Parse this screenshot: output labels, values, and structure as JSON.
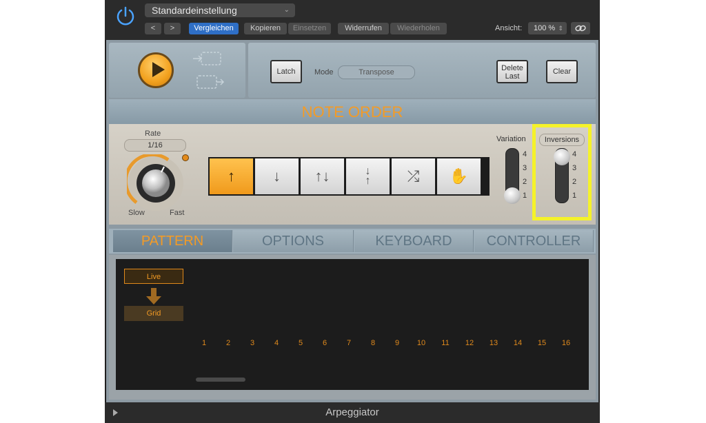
{
  "header": {
    "preset": "Standardeinstellung",
    "buttons": {
      "prev": "<",
      "next": ">",
      "compare": "Vergleichen",
      "copy": "Kopieren",
      "paste": "Einsetzen",
      "undo": "Widerrufen",
      "redo": "Wiederholen"
    },
    "view_label": "Ansicht:",
    "zoom": "100 %"
  },
  "controls": {
    "latch": "Latch",
    "mode_label": "Mode",
    "mode_value": "Transpose",
    "delete_last": "Delete Last",
    "clear": "Clear"
  },
  "note_order": {
    "title": "NOTE ORDER",
    "rate_label": "Rate",
    "rate_value": "1/16",
    "slow": "Slow",
    "fast": "Fast",
    "buttons": [
      "up",
      "down",
      "up-down",
      "outside-in",
      "random",
      "manual"
    ],
    "variation_label": "Variation",
    "variation_value": 1,
    "variation_ticks": [
      "4",
      "3",
      "2",
      "1"
    ],
    "inversions_label": "Inversions",
    "inversions_value": 4,
    "inversions_ticks": [
      "4",
      "3",
      "2",
      "1"
    ],
    "highlight_color": "#f5f22a"
  },
  "tabs": [
    "PATTERN",
    "OPTIONS",
    "KEYBOARD",
    "CONTROLLER"
  ],
  "pattern": {
    "live": "Live",
    "grid": "Grid",
    "steps": [
      "1",
      "2",
      "3",
      "4",
      "5",
      "6",
      "7",
      "8",
      "9",
      "10",
      "11",
      "12",
      "13",
      "14",
      "15",
      "16"
    ]
  },
  "footer": {
    "title": "Arpeggiator"
  },
  "colors": {
    "accent": "#f39b26",
    "blue": "#2f6fc6"
  }
}
